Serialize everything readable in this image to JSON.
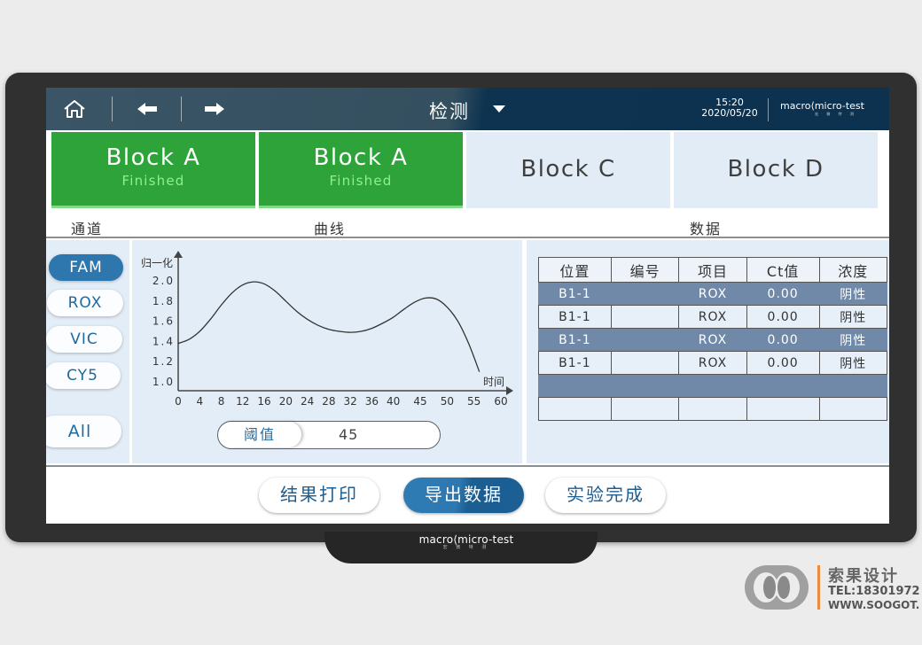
{
  "topbar": {
    "home_icon": "home-icon",
    "back_icon": "arrow-left-icon",
    "forward_icon": "arrow-right-icon",
    "title": "检测",
    "title_dropdown_icon": "caret-down-icon",
    "time": "15:20",
    "date": "2020/05/20",
    "brand": "macro",
    "brand2": "micro-test",
    "brand_sub": "宏 微 特 测"
  },
  "blocks": [
    {
      "name": "Block  A",
      "status": "Finished",
      "state": "finished"
    },
    {
      "name": "Block  A",
      "status": "Finished",
      "state": "finished"
    },
    {
      "name": "Block  C",
      "status": "",
      "state": "idle"
    },
    {
      "name": "Block  D",
      "status": "",
      "state": "idle"
    }
  ],
  "sections": {
    "channel": "通道",
    "curve": "曲线",
    "data": "数据"
  },
  "channels": [
    {
      "label": "FAM",
      "active": true
    },
    {
      "label": "ROX",
      "active": false
    },
    {
      "label": "VIC",
      "active": false
    },
    {
      "label": "CY5",
      "active": false
    },
    {
      "label": "All",
      "active": false
    }
  ],
  "chart_data": {
    "type": "line",
    "title": "",
    "xlabel": "时间",
    "ylabel": "归一化",
    "x_ticks": [
      "0",
      "4",
      "8",
      "12",
      "16",
      "20",
      "24",
      "28",
      "32",
      "36",
      "40",
      "45",
      "50",
      "55",
      "60"
    ],
    "y_ticks": [
      "1.0",
      "1.2",
      "1.4",
      "1.6",
      "1.8",
      "2.0"
    ],
    "ylim": [
      1.0,
      2.0
    ],
    "grid": false,
    "series": [
      {
        "name": "FAM",
        "x": [
          0,
          2,
          4,
          6,
          8,
          10,
          12,
          14,
          16,
          18,
          20,
          22,
          24,
          26,
          28,
          30,
          32,
          34,
          36,
          38,
          40,
          42,
          44,
          46,
          48,
          50,
          52,
          54,
          56
        ],
        "y": [
          1.38,
          1.42,
          1.5,
          1.62,
          1.76,
          1.88,
          1.96,
          1.99,
          1.97,
          1.9,
          1.8,
          1.7,
          1.62,
          1.56,
          1.52,
          1.5,
          1.49,
          1.5,
          1.53,
          1.58,
          1.64,
          1.72,
          1.79,
          1.83,
          1.82,
          1.74,
          1.6,
          1.38,
          1.1
        ]
      }
    ]
  },
  "threshold": {
    "label": "阈值",
    "value": "45"
  },
  "table": {
    "headers": [
      "位置",
      "编号",
      "项目",
      "Ct值",
      "浓度"
    ],
    "rows": [
      {
        "cells": [
          "B1-1",
          "",
          "ROX",
          "0.00",
          "阴性"
        ],
        "highlight": true
      },
      {
        "cells": [
          "B1-1",
          "",
          "ROX",
          "0.00",
          "阴性"
        ],
        "highlight": false
      },
      {
        "cells": [
          "B1-1",
          "",
          "ROX",
          "0.00",
          "阴性"
        ],
        "highlight": true
      },
      {
        "cells": [
          "B1-1",
          "",
          "ROX",
          "0.00",
          "阴性"
        ],
        "highlight": false
      },
      {
        "cells": [
          "",
          "",
          "",
          "",
          ""
        ],
        "highlight": true
      },
      {
        "cells": [
          "",
          "",
          "",
          "",
          ""
        ],
        "highlight": false
      }
    ]
  },
  "actions": [
    {
      "label": "结果打印",
      "primary": false
    },
    {
      "label": "导出数据",
      "primary": true
    },
    {
      "label": "实验完成",
      "primary": false
    }
  ],
  "device_logo": {
    "brand": "macro",
    "brand2": "micro-test",
    "sub": "宏 微 特 测"
  },
  "watermark": {
    "name": "索果设计",
    "tel": "TEL:18301972",
    "url": "WWW.SOOGOT."
  }
}
